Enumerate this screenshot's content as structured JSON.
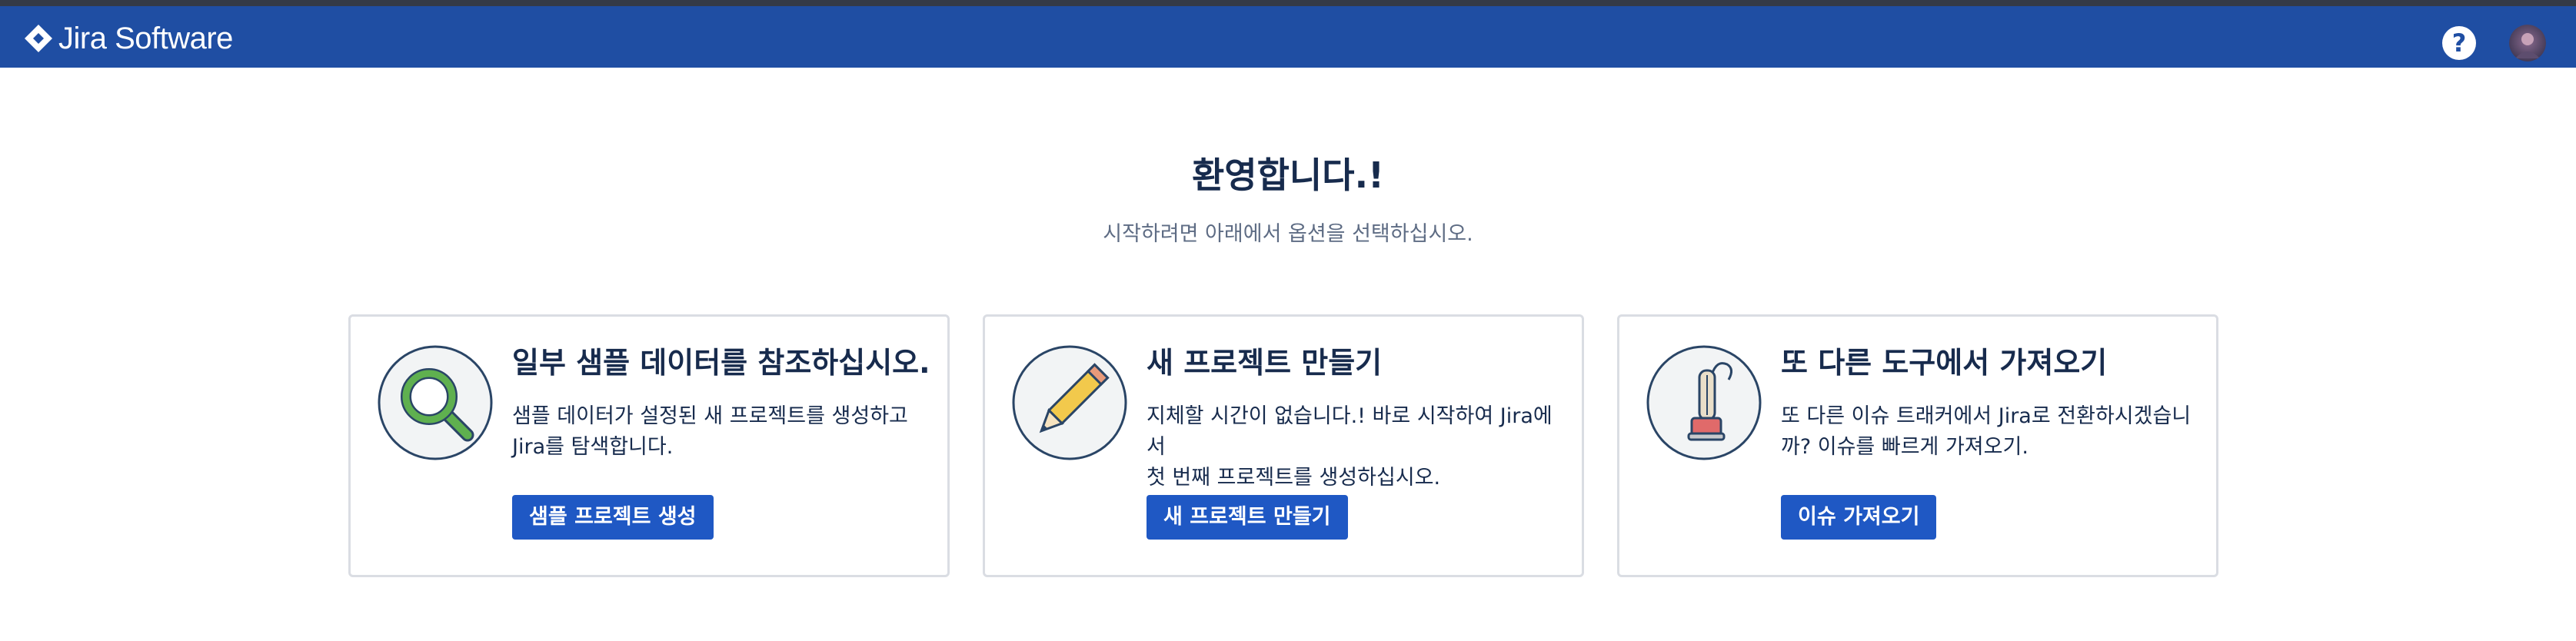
{
  "header": {
    "app_name": "Jira Software",
    "help_symbol": "?",
    "colors": {
      "navbar": "#1f4ea3",
      "topstrip": "#343a46"
    },
    "icons": [
      "jira-logo-icon",
      "help-icon",
      "user-avatar"
    ]
  },
  "main": {
    "title": "환영합니다.!",
    "subtitle": "시작하려면 아래에서 옵션을 선택하십시오.",
    "cards": [
      {
        "icon": "magnifier-icon",
        "title": "일부 샘플 데이터를 참조하십시오.",
        "desc_line1": "샘플 데이터가 설정된 새 프로젝트를 생성하고",
        "desc_line2": "Jira를 탐색합니다.",
        "button": "샘플 프로젝트 생성"
      },
      {
        "icon": "pencil-icon",
        "title": "새 프로젝트 만들기",
        "desc_line1": "지체할 시간이 없습니다.! 바로 시작하여 Jira에서",
        "desc_line2": "첫 번째 프로젝트를 생성하십시오.",
        "button": "새 프로젝트 만들기"
      },
      {
        "icon": "vacuum-cleaner-icon",
        "title": "또 다른 도구에서 가져오기",
        "desc_line1": "또 다른 이슈 트래커에서 Jira로 전환하시겠습니",
        "desc_line2": "까? 이슈를 빠르게 가져오기.",
        "button": "이슈 가져오기"
      }
    ],
    "button_color": "#1f58c4"
  }
}
